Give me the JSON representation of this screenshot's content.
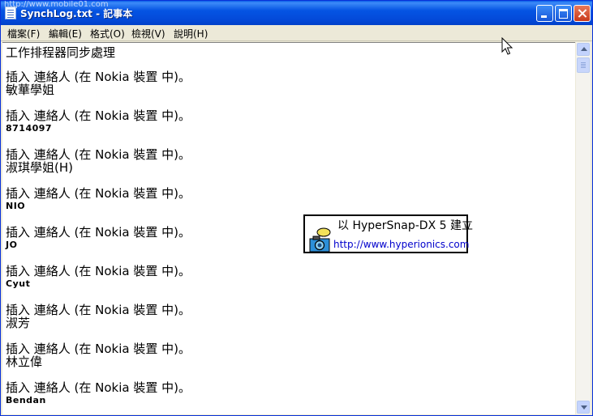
{
  "window": {
    "title": "SynchLog.txt - 記事本",
    "watermark": "http://www.mobile01.com"
  },
  "menu": [
    {
      "label": "檔案(F)"
    },
    {
      "label": "編輯(E)"
    },
    {
      "label": "格式(O)"
    },
    {
      "label": "檢視(V)"
    },
    {
      "label": "說明(H)"
    }
  ],
  "document": {
    "heading": "工作排程器同步處理",
    "entries": [
      {
        "action": "插入 連絡人 (在 Nokia 裝置 中)。",
        "name": "敏華學姐"
      },
      {
        "action": "插入 連絡人 (在 Nokia 裝置 中)。",
        "name": "8714097"
      },
      {
        "action": "插入 連絡人 (在 Nokia 裝置 中)。",
        "name": "淑琪學姐(H)"
      },
      {
        "action": "插入 連絡人 (在 Nokia 裝置 中)。",
        "name": "NIO"
      },
      {
        "action": "插入 連絡人 (在 Nokia 裝置 中)。",
        "name": "JO"
      },
      {
        "action": "插入 連絡人 (在 Nokia 裝置 中)。",
        "name": "Cyut"
      },
      {
        "action": "插入 連絡人 (在 Nokia 裝置 中)。",
        "name": "淑芳"
      },
      {
        "action": "插入 連絡人 (在 Nokia 裝置 中)。",
        "name": "林立偉"
      },
      {
        "action": "插入 連絡人 (在 Nokia 裝置 中)。",
        "name": "Bendan"
      }
    ]
  },
  "badge": {
    "line1": "以 HyperSnap-DX 5 建立",
    "line2": "http://www.hyperionics.com"
  },
  "icons": {
    "app": "notepad-icon",
    "minimize": "minimize-icon",
    "maximize": "maximize-icon",
    "close": "close-icon",
    "scroll_up": "arrow-up-icon",
    "scroll_down": "arrow-down-icon",
    "camera": "camera-icon",
    "cursor": "mouse-cursor-icon"
  },
  "colors": {
    "titlebar": "#0554E3",
    "close_button": "#C8391A",
    "menubar": "#ECE9D8",
    "link": "#0000CC"
  }
}
